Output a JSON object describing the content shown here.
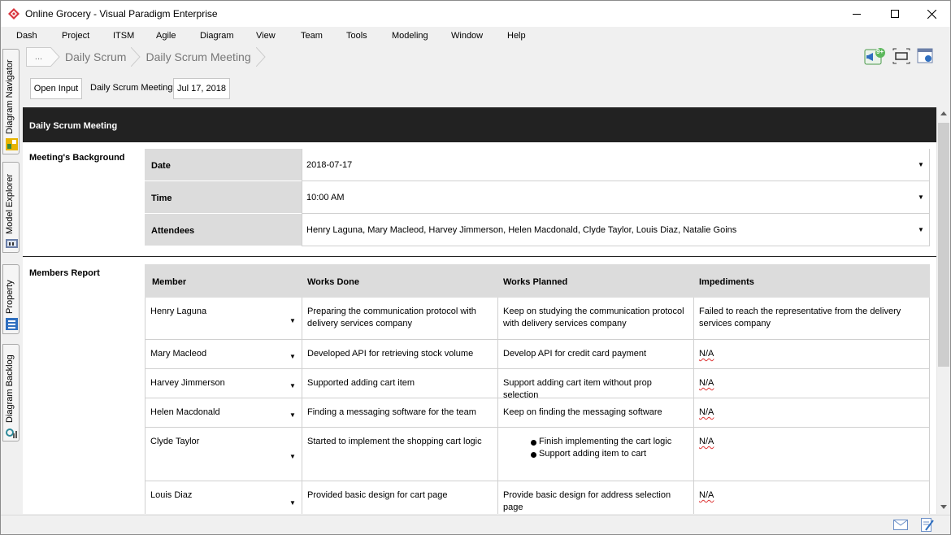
{
  "window": {
    "title": "Online Grocery - Visual Paradigm Enterprise"
  },
  "menu": [
    "Dash",
    "Project",
    "ITSM",
    "Agile",
    "Diagram",
    "View",
    "Team",
    "Tools",
    "Modeling",
    "Window",
    "Help"
  ],
  "side_tabs": [
    "Diagram Navigator",
    "Model Explorer",
    "Property",
    "Diagram Backlog"
  ],
  "breadcrumb": {
    "ellipsis": "...",
    "items": [
      "Daily Scrum",
      "Daily Scrum Meeting"
    ]
  },
  "toolbar": {
    "notification_badge": "9+",
    "open_input_label": "Open Input",
    "meeting_label": "Daily Scrum Meeting:",
    "meeting_date": "Jul 17, 2018"
  },
  "document": {
    "header": "Daily Scrum Meeting",
    "background": {
      "title": "Meeting's Background",
      "rows": [
        {
          "key": "Date",
          "value": "2018-07-17"
        },
        {
          "key": "Time",
          "value": "10:00 AM"
        },
        {
          "key": "Attendees",
          "value": "Henry Laguna, Mary Macleod, Harvey Jimmerson, Helen Macdonald, Clyde Taylor, Louis Diaz, Natalie Goins"
        }
      ]
    },
    "members_report": {
      "title": "Members Report",
      "columns": [
        "Member",
        "Works Done",
        "Works Planned",
        "Impediments"
      ],
      "rows": [
        {
          "member": "Henry Laguna",
          "done": "Preparing the communication protocol with delivery services company",
          "planned": "Keep on studying the communication protocol with delivery services company",
          "planned_list": [],
          "impediments": "Failed to reach the representative from the delivery services company"
        },
        {
          "member": "Mary Macleod",
          "done": "Developed API for retrieving stock volume",
          "planned": "Develop API for credit card payment",
          "planned_list": [],
          "impediments": "N/A"
        },
        {
          "member": "Harvey Jimmerson",
          "done": "Supported adding cart item",
          "planned": "Support adding cart item without prop selection",
          "planned_list": [],
          "impediments": "N/A"
        },
        {
          "member": "Helen Macdonald",
          "done": "Finding a messaging software for the team",
          "planned": "Keep on finding the messaging software",
          "planned_list": [],
          "impediments": "N/A"
        },
        {
          "member": "Clyde Taylor",
          "done": "Started to implement the shopping cart logic",
          "planned": "",
          "planned_list": [
            "Finish implementing the cart logic",
            "Support adding item to cart"
          ],
          "impediments": "N/A"
        },
        {
          "member": "Louis Diaz",
          "done": "Provided basic design for cart page",
          "planned": "Provide basic design for address selection page",
          "planned_list": [],
          "impediments": "N/A"
        }
      ]
    }
  },
  "colors": {
    "header_bg": "#222222",
    "table_header_bg": "#dcdcdc",
    "logo_red": "#d9363e"
  },
  "icons": [
    "notification-icon",
    "fit-diagram-icon",
    "layout-icon",
    "mail-icon",
    "edit-icon"
  ]
}
